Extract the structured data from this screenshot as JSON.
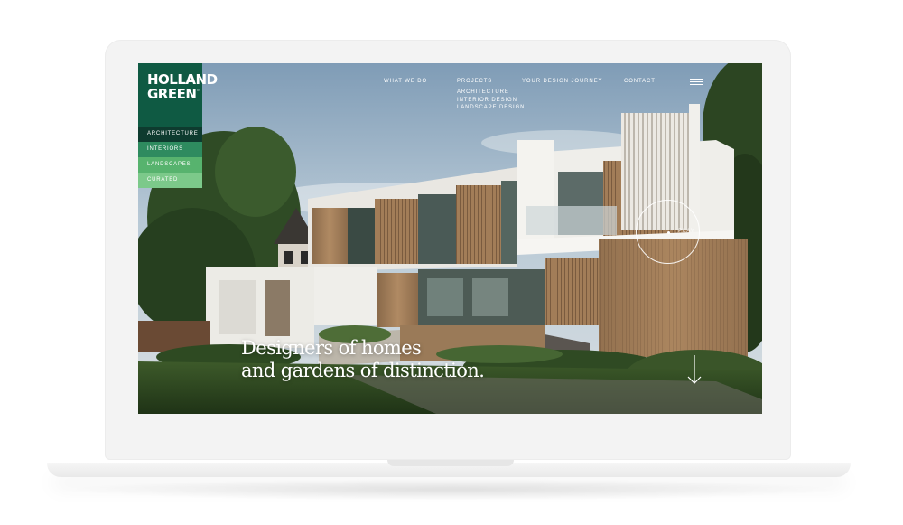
{
  "logo": {
    "line1": "HOLLAND",
    "line2": "GREEN",
    "trademark": "™"
  },
  "sidebar": {
    "items": [
      {
        "label": "ARCHITECTURE"
      },
      {
        "label": "INTERIORS"
      },
      {
        "label": "LANDSCAPES"
      },
      {
        "label": "CURATED"
      }
    ]
  },
  "nav": {
    "items": [
      {
        "label": "WHAT WE DO"
      },
      {
        "label": "PROJECTS"
      },
      {
        "label": "YOUR DESIGN JOURNEY"
      },
      {
        "label": "CONTACT"
      }
    ],
    "projects_sub": [
      {
        "label": "ARCHITECTURE"
      },
      {
        "label": "INTERIOR DESIGN"
      },
      {
        "label": "LANDSCAPE DESIGN"
      }
    ],
    "menu_icon": "hamburger-icon"
  },
  "hero": {
    "headline_line1": "Designers of homes",
    "headline_line2": "and gardens of distinction.",
    "play_label": "PLAY",
    "scroll_icon": "arrow-down-icon"
  },
  "colors": {
    "brand_green": "#0f5a43",
    "nav_dark": "#0e3b2f",
    "nav_mid": "#2e8b5f",
    "nav_light": "#57b36e",
    "nav_lighter": "#7cc98a"
  }
}
